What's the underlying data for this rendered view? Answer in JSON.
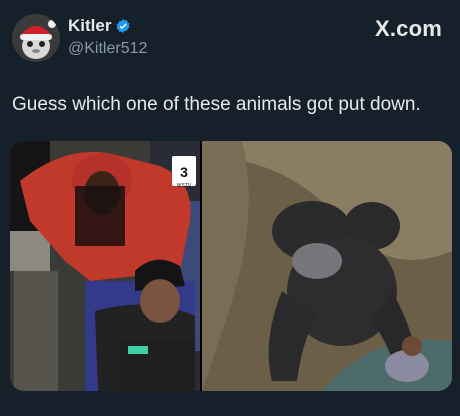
{
  "user": {
    "name": "Kitler",
    "handle": "@Kitler512",
    "verified_color": "#1d9bf0"
  },
  "brand": {
    "label": "X.com"
  },
  "tweet": {
    "text": "Guess which one of these animals got put down."
  },
  "media": {
    "left_panel": {
      "icon": "news-logo",
      "logo_text": "WSTV"
    },
    "right_panel": {
      "icon": "gorilla-scene"
    }
  },
  "colors": {
    "background": "#15202b",
    "text": "#e7e9ea",
    "secondary_text": "#8b98a5"
  }
}
